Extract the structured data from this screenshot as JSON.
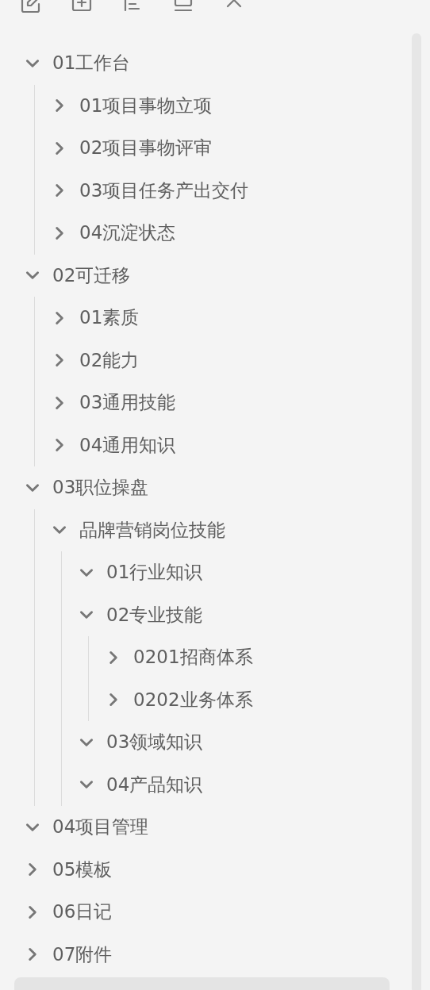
{
  "toolbar": {
    "buttons": [
      {
        "kind": "new-note"
      },
      {
        "kind": "new-folder"
      },
      {
        "kind": "sort"
      },
      {
        "kind": "collapse"
      },
      {
        "kind": "up"
      }
    ]
  },
  "tree": [
    {
      "label": "01工作台",
      "expanded": true,
      "children": [
        {
          "label": "01项目事物立项",
          "expanded": false
        },
        {
          "label": "02项目事物评审",
          "expanded": false
        },
        {
          "label": "03项目任务产出交付",
          "expanded": false
        },
        {
          "label": "04沉淀状态",
          "expanded": false
        }
      ]
    },
    {
      "label": "02可迁移",
      "expanded": true,
      "children": [
        {
          "label": "01素质",
          "expanded": false
        },
        {
          "label": "02能力",
          "expanded": false
        },
        {
          "label": "03通用技能",
          "expanded": false
        },
        {
          "label": "04通用知识",
          "expanded": false
        }
      ]
    },
    {
      "label": "03职位操盘",
      "expanded": true,
      "children": [
        {
          "label": "品牌营销岗位技能",
          "expanded": true,
          "children": [
            {
              "label": "01行业知识",
              "expanded": true
            },
            {
              "label": "02专业技能",
              "expanded": true,
              "children": [
                {
                  "label": "0201招商体系",
                  "expanded": false
                },
                {
                  "label": "0202业务体系",
                  "expanded": false
                }
              ]
            },
            {
              "label": "03领域知识",
              "expanded": true
            },
            {
              "label": "04产品知识",
              "expanded": true
            }
          ]
        }
      ]
    },
    {
      "label": "04项目管理",
      "expanded": true
    },
    {
      "label": "05模板",
      "expanded": false
    },
    {
      "label": "06日记",
      "expanded": false
    },
    {
      "label": "07附件",
      "expanded": false
    }
  ]
}
